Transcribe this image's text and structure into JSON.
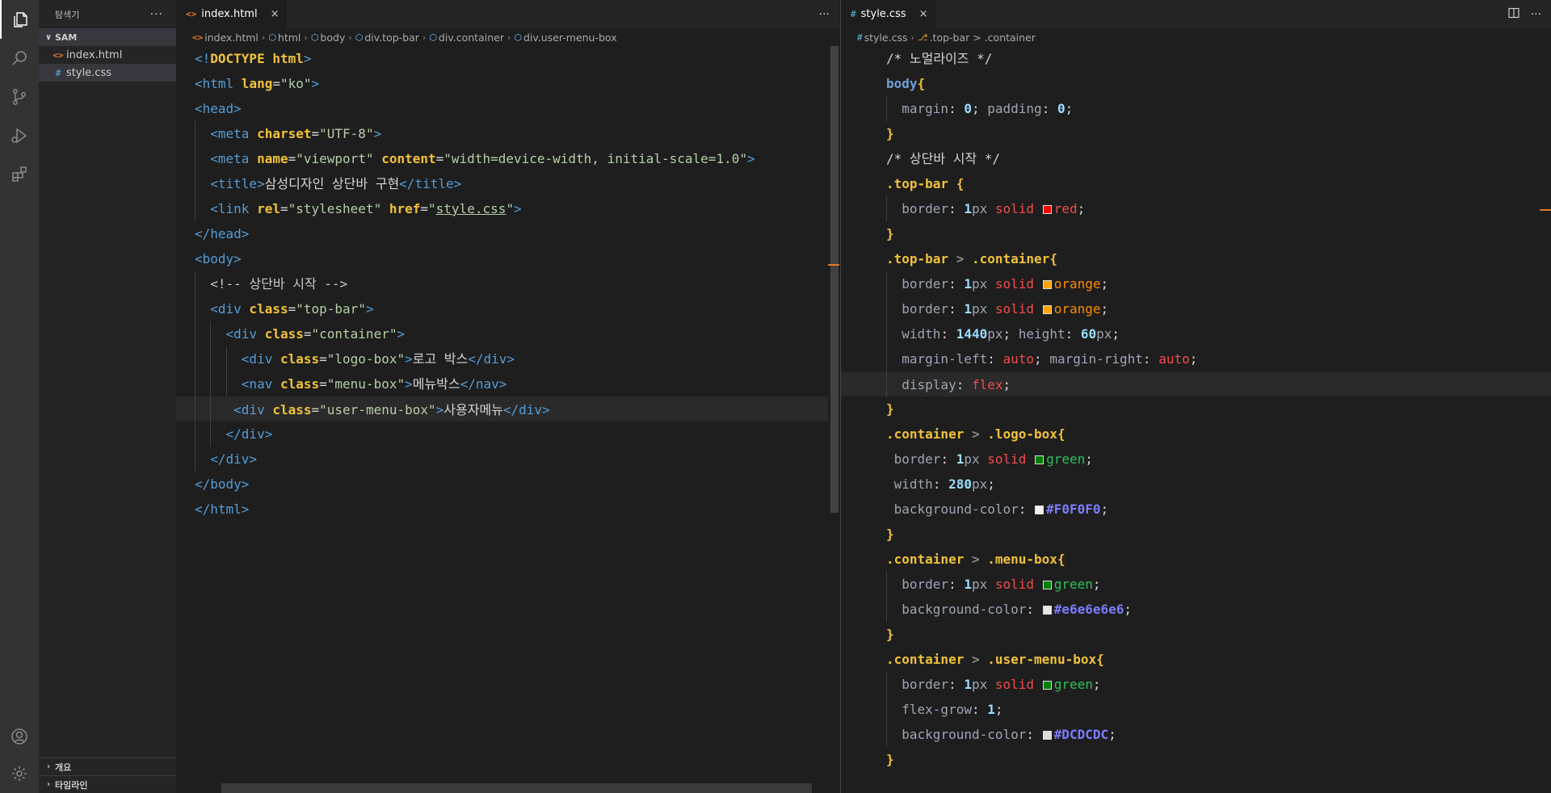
{
  "activity_bar": {
    "items": [
      "explorer-icon",
      "search-icon",
      "source-control-icon",
      "run-debug-icon",
      "extensions-icon"
    ],
    "bottom_items": [
      "account-icon",
      "settings-gear-icon"
    ]
  },
  "sidebar": {
    "title": "탐색기",
    "more": "···",
    "folder": "SAM",
    "files": [
      {
        "name": "index.html",
        "icon": "<>",
        "type": "html"
      },
      {
        "name": "style.css",
        "icon": "#",
        "type": "css"
      }
    ],
    "panels": [
      "개요",
      "타임라인"
    ]
  },
  "left_editor": {
    "tab": {
      "icon": "<>",
      "label": "index.html",
      "close": "×"
    },
    "more": "···",
    "breadcrumb": [
      "index.html",
      "html",
      "body",
      "div.top-bar",
      "div.container",
      "div.user-menu-box"
    ],
    "lines": [
      "<!DOCTYPE html>",
      "<html lang=\"ko\">",
      "<head>",
      "  <meta charset=\"UTF-8\">",
      "  <meta name=\"viewport\" content=\"width=device-width, initial-scale=1.0\">",
      "  <title>삼성디자인 상단바 구현</title>",
      "  <link rel=\"stylesheet\" href=\"style.css\">",
      "</head>",
      "<body>",
      "  <!-- 상단바 시작 -->",
      "  <div class=\"top-bar\">",
      "    <div class=\"container\">",
      "      <div class=\"logo-box\">로고 박스</div>",
      "      <nav class=\"menu-box\">메뉴박스</nav>",
      "     <div class=\"user-menu-box\">사용자메뉴</div>",
      "    </div>",
      "  </div>",
      "</body>",
      "</html>"
    ]
  },
  "right_editor": {
    "tab": {
      "icon": "#",
      "label": "style.css",
      "close": "×"
    },
    "actions": [
      "split-editor-icon",
      "···"
    ],
    "breadcrumb": [
      "style.css",
      ".top-bar > .container"
    ],
    "lines": [
      "/* 노멀라이즈 */",
      "body{",
      "  margin: 0; padding: 0;",
      "}",
      "/* 상단바 시작 */",
      ".top-bar {",
      "  border: 1px solid red;",
      "}",
      ".top-bar > .container{",
      "  border: 1px solid orange;",
      "  border: 1px solid orange;",
      "  width: 1440px; height: 60px;",
      "  margin-left: auto; margin-right: auto;",
      "  display: flex;",
      "}",
      ".container > .logo-box{",
      " border: 1px solid green;",
      " width: 280px;",
      " background-color: #F0F0F0;",
      "}",
      ".container > .menu-box{",
      "  border: 1px solid green;",
      "  background-color: #e6e6e6e6;",
      "}",
      ".container > .user-menu-box{",
      "  border: 1px solid green;",
      "  flex-grow: 1;",
      "  background-color: #DCDCDC;",
      "}"
    ]
  },
  "colors": {
    "red": "#ff0000",
    "orange": "#ffa500",
    "green": "#008000",
    "F0F0F0": "#F0F0F0",
    "e6e6e6e6": "#e6e6e6",
    "DCDCDC": "#DCDCDC"
  }
}
